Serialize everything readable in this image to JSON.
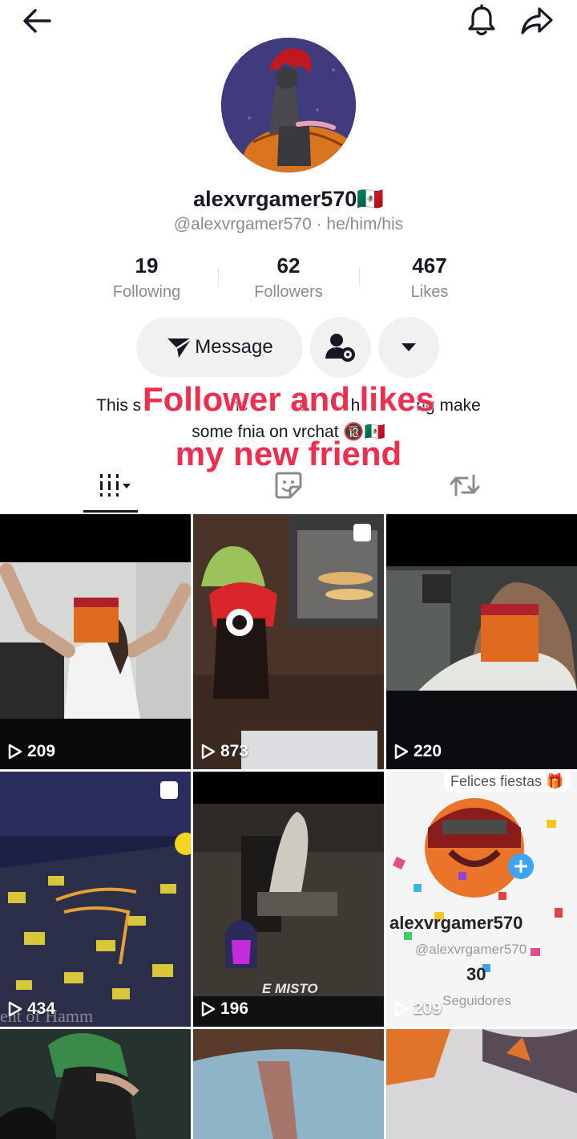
{
  "header": {
    "back_icon": "arrow-left",
    "bell_icon": "bell",
    "share_icon": "share-arrow"
  },
  "profile": {
    "username": "alexvrgamer570🇲🇽",
    "handle": "@alexvrgamer570 · he/him/his",
    "stats": [
      {
        "value": "19",
        "label": "Following"
      },
      {
        "value": "62",
        "label": "Followers"
      },
      {
        "value": "467",
        "label": "Likes"
      }
    ],
    "message_label": "Message",
    "bio_line1": "This s                   hc           d         h            ng make",
    "bio_line2": "some fnia on vrchat 🔞🇲🇽"
  },
  "overlay": {
    "line1": "Follower and likes",
    "line2": "my new friend"
  },
  "tabs": [
    {
      "name": "videos",
      "icon": "grid-bars"
    },
    {
      "name": "stickers",
      "icon": "sticker"
    },
    {
      "name": "reposts",
      "icon": "repost"
    }
  ],
  "videos": [
    {
      "views": "209"
    },
    {
      "views": "873"
    },
    {
      "views": "220"
    },
    {
      "views": "434",
      "caption": "ent of Hamm"
    },
    {
      "views": "196",
      "caption": "E MISTO"
    },
    {
      "views": "209",
      "top_text": "Felices fiestas 🎁",
      "name_text": "alexvrgamer570",
      "sub_text": "@alexvrgamer570",
      "num_text": "30",
      "foot_text": "Seguidores"
    },
    {
      "views": ""
    },
    {
      "views": ""
    },
    {
      "views": ""
    }
  ],
  "colors": {
    "accent_red": "#ee2e4e",
    "text_primary": "#161823",
    "text_secondary": "#8a8b91"
  }
}
